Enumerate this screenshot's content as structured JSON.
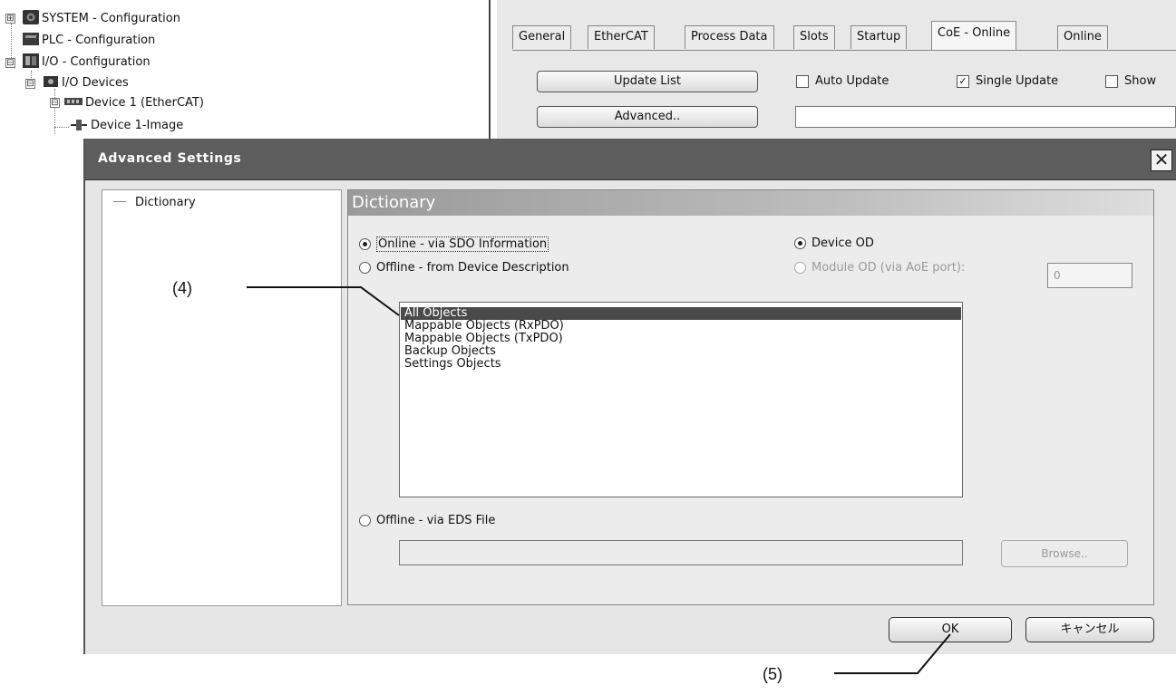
{
  "tree": {
    "items": [
      {
        "label": "SYSTEM - Configuration",
        "expander": "⊞"
      },
      {
        "label": "PLC - Configuration",
        "expander": ""
      },
      {
        "label": "I/O - Configuration",
        "expander": "⊟"
      },
      {
        "label": "I/O Devices",
        "expander": "⊟"
      },
      {
        "label": "Device 1 (EtherCAT)",
        "expander": "⊟"
      },
      {
        "label": "Device 1-Image",
        "expander": ""
      }
    ]
  },
  "tabs": [
    "General",
    "EtherCAT",
    "Process Data",
    "Slots",
    "Startup",
    "CoE - Online",
    "Online"
  ],
  "active_tab": "CoE - Online",
  "coe_panel": {
    "update_list": "Update List",
    "advanced": "Advanced..",
    "auto_update": "Auto Update",
    "single_update": "Single Update",
    "show": "Show"
  },
  "dialog": {
    "title": "Advanced Settings",
    "close_glyph": "✕",
    "nav_item": "Dictionary",
    "section_title": "Dictionary",
    "radio_online_sdo": "Online - via SDO Information",
    "radio_offline_desc": "Offline - from Device Description",
    "radio_device_od": "Device OD",
    "radio_module_od": "Module OD (via AoE port):",
    "module_od_value": "0",
    "objects": [
      "All Objects",
      "Mappable Objects (RxPDO)",
      "Mappable Objects (TxPDO)",
      "Backup Objects",
      "Settings Objects"
    ],
    "selected_object": "All Objects",
    "radio_offline_eds": "Offline - via EDS File",
    "browse": "Browse..",
    "ok": "OK",
    "cancel": "キャンセル"
  },
  "annotations": {
    "callout_4": "(4)",
    "callout_5": "(5)"
  },
  "colors": {
    "titlebar": "#5d5d5d",
    "selection": "#4a4a4a",
    "dialog_bg": "#e6e6e6"
  }
}
